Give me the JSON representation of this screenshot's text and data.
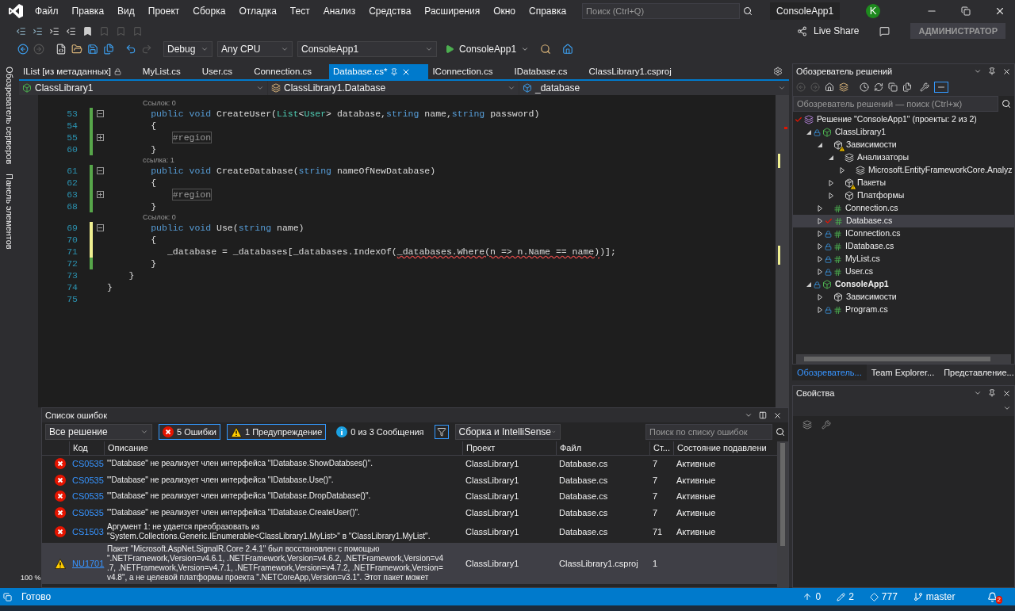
{
  "menu": [
    "Файл",
    "Правка",
    "Вид",
    "Проект",
    "Сборка",
    "Отладка",
    "Тест",
    "Анализ",
    "Средства",
    "Расширения",
    "Окно",
    "Справка"
  ],
  "search": {
    "placeholder": "Поиск (Ctrl+Q)"
  },
  "window": {
    "title": "ConsoleApp1",
    "avatar": "K"
  },
  "toolbar": {
    "live_share": "Live Share",
    "admin": "АДМИНИСТРАТОР",
    "configuration": "Debug",
    "platform": "Any CPU",
    "startup_project": "ConsoleApp1",
    "run": "ConsoleApp1"
  },
  "left_strip": [
    "Обозреватель серверов",
    "Панель элементов"
  ],
  "editor_tabs": [
    {
      "label": "IList [из метаданных]",
      "selected": false,
      "locked": true
    },
    {
      "label": "MyList.cs",
      "selected": false,
      "locked": false
    },
    {
      "label": "User.cs",
      "selected": false,
      "locked": false
    },
    {
      "label": "Connection.cs",
      "selected": false,
      "locked": false
    },
    {
      "label": "Database.cs*",
      "selected": true,
      "locked": false
    },
    {
      "label": "IConnection.cs",
      "selected": false,
      "locked": false
    },
    {
      "label": "IDatabase.cs",
      "selected": false,
      "locked": false
    },
    {
      "label": "ClassLibrary1.csproj",
      "selected": false,
      "locked": false
    }
  ],
  "nav_bar": [
    "ClassLibrary1",
    "ClassLibrary1.Database",
    "_database"
  ],
  "code_lines": [
    {
      "kind": "lens",
      "text": "Ссылок: 0"
    },
    {
      "kind": "code",
      "number": "53",
      "collapsed": false,
      "saved": true,
      "tokens": [
        {
          "t": "        public void",
          "kind": "keyword"
        },
        {
          "t": " CreateUser("
        },
        {
          "t": "List",
          "kind": "type"
        },
        {
          "t": "<"
        },
        {
          "t": "User",
          "kind": "type"
        },
        {
          "t": "> database,"
        },
        {
          "t": "string",
          "kind": "keyword"
        },
        {
          "t": " name,"
        },
        {
          "t": "string",
          "kind": "keyword"
        },
        {
          "t": " password)"
        }
      ]
    },
    {
      "kind": "code",
      "number": "54",
      "saved": true,
      "tokens": [
        {
          "t": "        {"
        }
      ]
    },
    {
      "kind": "code",
      "number": "55",
      "collapsed": true,
      "saved": true,
      "tokens": [
        {
          "t": "            #region",
          "kind": "region"
        }
      ]
    },
    {
      "kind": "code",
      "number": "60",
      "saved": true,
      "tokens": [
        {
          "t": "        }"
        }
      ]
    },
    {
      "kind": "lens",
      "text": "ссылка: 1"
    },
    {
      "kind": "code",
      "number": "61",
      "collapsed": false,
      "saved": true,
      "tokens": [
        {
          "t": "        public void",
          "kind": "keyword"
        },
        {
          "t": " CreateDatabase("
        },
        {
          "t": "string",
          "kind": "keyword"
        },
        {
          "t": " nameOfNewDatabase)"
        }
      ]
    },
    {
      "kind": "code",
      "number": "62",
      "saved": true,
      "tokens": [
        {
          "t": "        {"
        }
      ]
    },
    {
      "kind": "code",
      "number": "63",
      "collapsed": true,
      "saved": true,
      "tokens": [
        {
          "t": "            #region",
          "kind": "region"
        }
      ]
    },
    {
      "kind": "code",
      "number": "68",
      "saved": true,
      "tokens": [
        {
          "t": "        }"
        }
      ]
    },
    {
      "kind": "lens",
      "text": "Ссылок: 0"
    },
    {
      "kind": "code",
      "number": "69",
      "collapsed": false,
      "saved": false,
      "tokens": [
        {
          "t": "        public void",
          "kind": "keyword"
        },
        {
          "t": " Use("
        },
        {
          "t": "string",
          "kind": "keyword"
        },
        {
          "t": " name)"
        }
      ]
    },
    {
      "kind": "code",
      "number": "70",
      "saved": false,
      "tokens": [
        {
          "t": "        {"
        }
      ]
    },
    {
      "kind": "code",
      "number": "71",
      "saved": false,
      "tokens": [
        {
          "t": "           _database = _databases[_databases.IndexOf("
        },
        {
          "t": "_databases.Where(n => n.Name == name)",
          "kind": "error"
        },
        {
          "t": ")];"
        }
      ]
    },
    {
      "kind": "code",
      "number": "72",
      "saved": true,
      "tokens": [
        {
          "t": "        }"
        }
      ]
    },
    {
      "kind": "code",
      "number": "73",
      "tokens": [
        {
          "t": "    }"
        }
      ]
    },
    {
      "kind": "code",
      "number": "74",
      "tokens": [
        {
          "t": "}"
        }
      ]
    },
    {
      "kind": "code",
      "number": "75"
    }
  ],
  "editor_zoom": "100 %",
  "error_list": {
    "title": "Список ошибок",
    "scope": "Все решение",
    "filters": [
      {
        "kind": "error",
        "label": "5 Ошибки",
        "on": true
      },
      {
        "kind": "warning",
        "label": "1 Предупреждение",
        "on": true
      },
      {
        "kind": "info",
        "label": "0 из 3 Сообщения",
        "on": false
      }
    ],
    "source": "Сборка и IntelliSense",
    "search": {
      "placeholder": "Поиск по списку ошибок"
    },
    "columns": [
      "Код",
      "Описание",
      "Проект",
      "Файл",
      "Ст...",
      "Состояние подавлени"
    ],
    "rows": [
      {
        "kind": "error",
        "code": "CS0535",
        "description": [
          "'\"Database\" не реализует член интерфейса \"IDatabase.ShowDatabses()\"."
        ],
        "project": "ClassLibrary1",
        "file": "Database.cs",
        "line": "7",
        "state": "Активные",
        "selected": false
      },
      {
        "kind": "error",
        "code": "CS0535",
        "description": [
          "'\"Database\" не реализует член интерфейса \"IDatabase.Use()\"."
        ],
        "project": "ClassLibrary1",
        "file": "Database.cs",
        "line": "7",
        "state": "Активные",
        "selected": false
      },
      {
        "kind": "error",
        "code": "CS0535",
        "description": [
          "'\"Database\" не реализует член интерфейса \"IDatabase.DropDatabase()\"."
        ],
        "project": "ClassLibrary1",
        "file": "Database.cs",
        "line": "7",
        "state": "Активные",
        "selected": false
      },
      {
        "kind": "error",
        "code": "CS0535",
        "description": [
          "'\"Database\" не реализует член интерфейса \"IDatabase.CreateUser()\"."
        ],
        "project": "ClassLibrary1",
        "file": "Database.cs",
        "line": "7",
        "state": "Активные",
        "selected": false
      },
      {
        "kind": "error",
        "code": "CS1503",
        "description": [
          "Аргумент 1: не удается преобразовать из",
          "\"System.Collections.Generic.IEnumerable<ClassLibrary1.MyList>\" в \"ClassLibrary1.MyList\"."
        ],
        "project": "ClassLibrary1",
        "file": "Database.cs",
        "line": "71",
        "state": "Активные",
        "selected": false
      },
      {
        "kind": "warning",
        "code": "NU1701",
        "description": [
          "Пакет \"Microsoft.AspNet.SignalR.Core 2.4.1\" был восстановлен с помощью",
          "\".NETFramework,Version=v4.6.1, .NETFramework,Version=v4.6.2, .NETFramework,Version=v4",
          ".7, .NETFramework,Version=v4.7.1, .NETFramework,Version=v4.7.2, .NETFramework,Version=",
          "v4.8\", а не целевой платформы проекта \".NETCoreApp,Version=v3.1\". Этот пакет может"
        ],
        "project": "ClassLibrary1",
        "file": "ClassLibrary1.csproj",
        "line": "1",
        "selected": true
      }
    ]
  },
  "solution_explorer": {
    "title": "Обозреватель решений",
    "search": {
      "placeholder": "Обозреватель решений — поиск (Ctrl+ж)"
    },
    "tree": [
      {
        "kind": "solution",
        "label": "Решение \"ConsoleApp1\" (проекты: 2 из 2)",
        "modified": true,
        "checked_in": false,
        "selected": false,
        "children": [
          {
            "kind": "project",
            "label": "ClassLibrary1",
            "modified": false,
            "checked_in": true,
            "expanded": true,
            "selected": false,
            "children": [
              {
                "kind": "dependencies",
                "label": "Зависимости",
                "warning": true,
                "expanded": true,
                "selected": false,
                "children": [
                  {
                    "kind": "analyzers",
                    "label": "Анализаторы",
                    "expanded": true,
                    "selected": false,
                    "children": [
                      {
                        "kind": "analyzer",
                        "label": "Microsoft.EntityFrameworkCore.Analyz",
                        "expanded": false,
                        "selected": false
                      }
                    ]
                  },
                  {
                    "kind": "packages",
                    "label": "Пакеты",
                    "warning": true,
                    "expanded": false,
                    "selected": false
                  },
                  {
                    "kind": "platforms",
                    "label": "Платформы",
                    "expanded": false,
                    "selected": false
                  }
                ]
              },
              {
                "kind": "file",
                "label": "Connection.cs",
                "modified": false,
                "checked_in": false,
                "expanded": false,
                "selected": false
              },
              {
                "kind": "file",
                "label": "Database.cs",
                "modified": true,
                "checked_in": false,
                "expanded": false,
                "selected": true
              },
              {
                "kind": "file",
                "label": "IConnection.cs",
                "modified": false,
                "checked_in": true,
                "expanded": false,
                "selected": false
              },
              {
                "kind": "file",
                "label": "IDatabase.cs",
                "modified": false,
                "checked_in": true,
                "expanded": false,
                "selected": false
              },
              {
                "kind": "file",
                "label": "MyList.cs",
                "modified": false,
                "checked_in": true,
                "expanded": false,
                "selected": false
              },
              {
                "kind": "file",
                "label": "User.cs",
                "modified": false,
                "checked_in": true,
                "expanded": false,
                "selected": false
              }
            ]
          },
          {
            "kind": "project",
            "label": "ConsoleApp1",
            "modified": false,
            "checked_in": true,
            "startup": true,
            "expanded": true,
            "selected": false,
            "children": [
              {
                "kind": "dependencies",
                "label": "Зависимости",
                "expanded": false,
                "selected": false
              },
              {
                "kind": "file",
                "label": "Program.cs",
                "modified": false,
                "checked_in": true,
                "expanded": false,
                "selected": false
              }
            ]
          }
        ]
      }
    ],
    "tabs": [
      {
        "label": "Обозреватель...",
        "selected": true
      },
      {
        "label": "Team Explorer...",
        "selected": false
      },
      {
        "label": "Представление...",
        "selected": false
      }
    ]
  },
  "properties": {
    "title": "Свойства"
  },
  "status_bar": {
    "text": "Готово",
    "up": "0",
    "edits": "2",
    "changes": "777",
    "branch": "master",
    "notifications": "2"
  }
}
